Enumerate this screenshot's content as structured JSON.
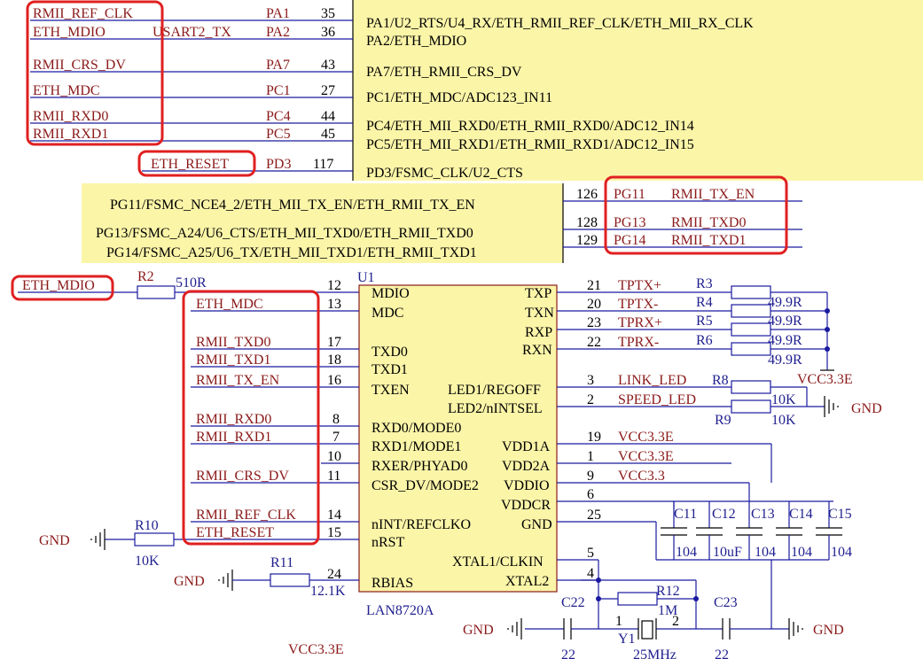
{
  "colors": {
    "yellow": "#fbf5a8",
    "net": "#8b1a1a",
    "wire": "#1a1aa0",
    "highlight": "#e02020"
  },
  "mcu_top": {
    "rows": [
      {
        "net": "RMII_REF_CLK",
        "pad": "PA1",
        "pin": "35",
        "func": "PA1/U2_RTS/U4_RX/ETH_RMII_REF_CLK/ETH_MII_RX_CLK"
      },
      {
        "net": "ETH_MDIO",
        "alt": "USART2_TX",
        "pad": "PA2",
        "pin": "36",
        "func": "PA2/ETH_MDIO"
      },
      {
        "net": "RMII_CRS_DV",
        "pad": "PA7",
        "pin": "43",
        "func": "PA7/ETH_RMII_CRS_DV"
      },
      {
        "net": "ETH_MDC",
        "pad": "PC1",
        "pin": "27",
        "func": "PC1/ETH_MDC/ADC123_IN11"
      },
      {
        "net": "RMII_RXD0",
        "pad": "PC4",
        "pin": "44",
        "func": "PC4/ETH_MII_RXD0/ETH_RMII_RXD0/ADC12_IN14"
      },
      {
        "net": "RMII_RXD1",
        "pad": "PC5",
        "pin": "45",
        "func": "PC5/ETH_MII_RXD1/ETH_RMII_RXD1/ADC12_IN15"
      },
      {
        "net": "ETH_RESET",
        "pad": "PD3",
        "pin": "117",
        "func": "PD3/FSMC_CLK/U2_CTS"
      }
    ]
  },
  "mcu_mid": {
    "rows": [
      {
        "func": "PG11/FSMC_NCE4_2/ETH_MII_TX_EN/ETH_RMII_TX_EN",
        "pin": "126",
        "pad": "PG11",
        "net": "RMII_TX_EN"
      },
      {
        "func": "PG13/FSMC_A24/U6_CTS/ETH_MII_TXD0/ETH_RMII_TXD0",
        "pin": "128",
        "pad": "PG13",
        "net": "RMII_TXD0"
      },
      {
        "func": "PG14/FSMC_A25/U6_TX/ETH_MII_TXD1/ETH_RMII_TXD1",
        "pin": "129",
        "pad": "PG14",
        "net": "RMII_TXD1"
      }
    ]
  },
  "mdio": {
    "net": "ETH_MDIO",
    "res": "R2",
    "val": "510R"
  },
  "chip": {
    "ref": "U1",
    "part": "LAN8720A",
    "left_pins": [
      {
        "num": "12",
        "name": "MDIO",
        "net": ""
      },
      {
        "num": "13",
        "name": "MDC",
        "net": "ETH_MDC"
      },
      {
        "num": "17",
        "name": "TXD0",
        "net": "RMII_TXD0"
      },
      {
        "num": "18",
        "name": "TXD1",
        "net": "RMII_TXD1"
      },
      {
        "num": "16",
        "name": "TXEN",
        "net": "RMII_TX_EN"
      },
      {
        "num": "8",
        "name": "RXD0/MODE0",
        "net": "RMII_RXD0"
      },
      {
        "num": "7",
        "name": "RXD1/MODE1",
        "net": "RMII_RXD1"
      },
      {
        "num": "10",
        "name": "RXER/PHYAD0",
        "net": ""
      },
      {
        "num": "11",
        "name": "CSR_DV/MODE2",
        "net": "RMII_CRS_DV"
      },
      {
        "num": "14",
        "name": "nINT/REFCLKO",
        "net": "RMII_REF_CLK"
      },
      {
        "num": "15",
        "name": "nRST",
        "net": "ETH_RESET"
      },
      {
        "num": "24",
        "name": "RBIAS",
        "net": ""
      }
    ],
    "right_pins": [
      {
        "num": "21",
        "name": "TXP",
        "net": "TPTX+"
      },
      {
        "num": "20",
        "name": "TXN",
        "net": "TPTX-"
      },
      {
        "num": "23",
        "name": "RXP",
        "net": "TPRX+"
      },
      {
        "num": "22",
        "name": "RXN",
        "net": "TPRX-"
      },
      {
        "num": "3",
        "name": "LED1/REGOFF",
        "net": "LINK_LED"
      },
      {
        "num": "2",
        "name": "LED2/nINTSEL",
        "net": "SPEED_LED"
      },
      {
        "num": "19",
        "name": "VDD1A",
        "net": "VCC3.3E"
      },
      {
        "num": "1",
        "name": "VDD2A",
        "net": "VCC3.3E"
      },
      {
        "num": "9",
        "name": "VDDIO",
        "net": "VCC3.3"
      },
      {
        "num": "6",
        "name": "VDDCR",
        "net": ""
      },
      {
        "num": "25",
        "name": "GND",
        "net": ""
      },
      {
        "num": "5",
        "name": "XTAL1/CLKIN",
        "net": ""
      },
      {
        "num": "4",
        "name": "XTAL2",
        "net": ""
      }
    ]
  },
  "resistors": {
    "r3": "R3",
    "r4": "R4",
    "r5": "R5",
    "r6": "R6",
    "r_val": "49.9R",
    "r8": "R8",
    "r9": "R9",
    "r_led_val": "10K",
    "r10": "R10",
    "r10_val": "10K",
    "r11": "R11",
    "r11_val": "12.1K",
    "r12": "R12",
    "r12_val": "1M"
  },
  "caps": {
    "c11": "C11",
    "c12": "C12",
    "c13": "C13",
    "c14": "C14",
    "c15": "C15",
    "c11_val": "104",
    "c12_val": "10uF",
    "c13_val": "104",
    "c14_val": "104",
    "c15_val": "104",
    "c22": "C22",
    "c23": "C23",
    "c22_val": "22",
    "c23_val": "22"
  },
  "crystal": {
    "ref": "Y1",
    "val": "25MHz",
    "pin1": "1",
    "pin2": "2"
  },
  "power": {
    "gnd": "GND",
    "vcc_e": "VCC3.3E",
    "vcc": "VCC3.3"
  }
}
